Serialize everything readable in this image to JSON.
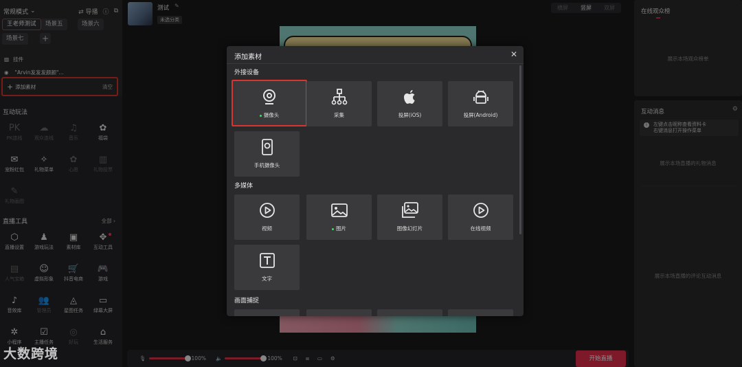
{
  "left": {
    "mode": "常规模式",
    "guide": "导播",
    "scenes": [
      "王老师测试",
      "场景五",
      "场景六",
      "场景七"
    ],
    "plugin_header": "挂件",
    "plugin_item": "\"Arvin发发发颜颜\"...",
    "add_material": "添加素材",
    "clear": "清空",
    "interactive_title": "互动玩法",
    "interactive": [
      {
        "label": "PK连线",
        "icon": "PK"
      },
      {
        "label": "观众连线",
        "icon": "☁"
      },
      {
        "label": "音乐",
        "icon": "♫"
      },
      {
        "label": "福袋",
        "icon": "✿"
      },
      {
        "label": "宠粉红包",
        "icon": "✉"
      },
      {
        "label": "礼物菜单",
        "icon": "✧"
      },
      {
        "label": "心愿",
        "icon": "✿"
      },
      {
        "label": "礼物投票",
        "icon": "▥"
      },
      {
        "label": "礼物画图",
        "icon": "✎"
      }
    ],
    "tools_title": "直播工具",
    "tools_more": "全部",
    "tools": [
      {
        "label": "直播设置",
        "icon": "⬡"
      },
      {
        "label": "游戏玩法",
        "icon": "♟"
      },
      {
        "label": "素材库",
        "icon": "▣"
      },
      {
        "label": "互动工具",
        "icon": "✥"
      },
      {
        "label": "人气宝箱",
        "icon": "▤"
      },
      {
        "label": "虚拟形象",
        "icon": "☺"
      },
      {
        "label": "抖音电商",
        "icon": "🛒"
      },
      {
        "label": "游戏",
        "icon": "🎮"
      },
      {
        "label": "音效库",
        "icon": "♪"
      },
      {
        "label": "管理员",
        "icon": "👥"
      },
      {
        "label": "星图任务",
        "icon": "◬"
      },
      {
        "label": "绿幕大屏",
        "icon": "▭"
      },
      {
        "label": "小程序",
        "icon": "✲"
      },
      {
        "label": "主播任务",
        "icon": "☑"
      },
      {
        "label": "好玩",
        "icon": "◎"
      },
      {
        "label": "生活服务",
        "icon": "⌂"
      }
    ]
  },
  "center": {
    "title": "测试",
    "tag": "未选分类",
    "orientation": [
      "横屏",
      "竖屏",
      "双屏"
    ],
    "mic_volume": "100%",
    "speaker_volume": "100%",
    "start_button": "开始直播"
  },
  "right": {
    "audience_title": "在线观众榜",
    "audience_empty": "展示本场观众榜单",
    "messages_title": "互动消息",
    "tip_line1": "左键点击昵称查看资料卡",
    "tip_line2": "右键消息打开操作菜单",
    "gift_empty": "展示本场直播的礼物消息",
    "comment_empty": "展示本场直播的评论互动消息"
  },
  "modal": {
    "title": "添加素材",
    "groups": [
      {
        "title": "外接设备",
        "items": [
          {
            "label": "摄像头",
            "icon": "camera-icon",
            "dot": true,
            "selected": true
          },
          {
            "label": "采集",
            "icon": "capture-icon"
          },
          {
            "label": "投屏(iOS)",
            "icon": "apple-icon"
          },
          {
            "label": "投屏(Android)",
            "icon": "android-icon"
          },
          {
            "label": "手机摄像头",
            "icon": "phone-camera-icon"
          }
        ]
      },
      {
        "title": "多媒体",
        "items": [
          {
            "label": "视频",
            "icon": "play-icon"
          },
          {
            "label": "图片",
            "icon": "image-icon",
            "dot": true
          },
          {
            "label": "图像幻灯片",
            "icon": "slideshow-icon"
          },
          {
            "label": "在线视频",
            "icon": "play-icon"
          },
          {
            "label": "文字",
            "icon": "text-icon"
          }
        ]
      },
      {
        "title": "画面捕捉",
        "items": []
      }
    ]
  },
  "watermark": "大数跨境"
}
